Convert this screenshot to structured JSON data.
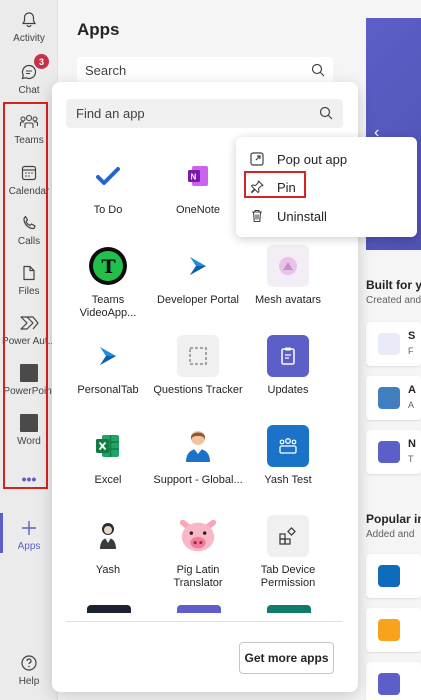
{
  "rail": {
    "items": [
      {
        "label": "Activity",
        "icon": "bell-icon"
      },
      {
        "label": "Chat",
        "icon": "chat-icon",
        "badge": "3"
      },
      {
        "label": "Teams",
        "icon": "teams-icon"
      },
      {
        "label": "Calendar",
        "icon": "calendar-icon"
      },
      {
        "label": "Calls",
        "icon": "phone-icon"
      },
      {
        "label": "Files",
        "icon": "file-icon"
      },
      {
        "label": "Power Aut...",
        "icon": "power-automate-icon"
      },
      {
        "label": "PowerPoint",
        "icon": "powerpoint-icon"
      },
      {
        "label": "Word",
        "icon": "word-icon"
      },
      {
        "label": "•••",
        "icon": "more-icon"
      },
      {
        "label": "Apps",
        "icon": "plus-icon"
      },
      {
        "label": "Help",
        "icon": "help-icon"
      }
    ]
  },
  "apps_panel": {
    "title": "Apps",
    "search_placeholder": "Search"
  },
  "popup": {
    "find_placeholder": "Find an app",
    "apps": [
      {
        "name": "To Do"
      },
      {
        "name": "OneNote"
      },
      {
        "name": "Teams VideoApp..."
      },
      {
        "name": "Developer Portal"
      },
      {
        "name": "Mesh avatars"
      },
      {
        "name": "PersonalTab"
      },
      {
        "name": "Questions Tracker"
      },
      {
        "name": "Updates"
      },
      {
        "name": "Excel"
      },
      {
        "name": "Support - Global..."
      },
      {
        "name": "Yash Test"
      },
      {
        "name": "Yash"
      },
      {
        "name": "Pig Latin Translator"
      },
      {
        "name": "Tab Device Permission"
      }
    ],
    "get_more_label": "Get more apps"
  },
  "context_menu": {
    "items": [
      {
        "label": "Pop out app",
        "icon": "pop-out-icon"
      },
      {
        "label": "Pin",
        "icon": "pin-icon"
      },
      {
        "label": "Uninstall",
        "icon": "trash-icon"
      }
    ]
  },
  "right": {
    "built_title": "Built for y",
    "built_sub": "Created and",
    "cards": [
      {
        "l": "S",
        "s": "F"
      },
      {
        "l": "A",
        "s": "A"
      },
      {
        "l": "N",
        "s": "T"
      }
    ],
    "popular_title": "Popular in",
    "popular_sub": "Added and"
  },
  "colors": {
    "accent": "#5b5fc7",
    "highlight": "#d92121",
    "badge": "#c4314b"
  }
}
